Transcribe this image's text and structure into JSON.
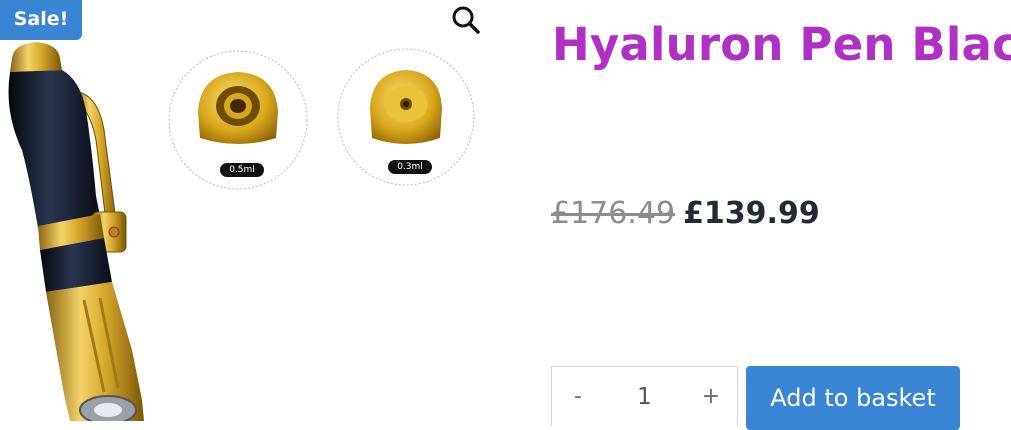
{
  "badge": {
    "sale": "Sale!"
  },
  "gallery": {
    "tip_large_label": "0.5ml",
    "tip_small_label": "0.3ml"
  },
  "product": {
    "title": "Hyaluron Pen Black",
    "old_price": "£176.49",
    "new_price": "£139.99"
  },
  "cart": {
    "minus": "-",
    "quantity": "1",
    "plus": "+",
    "add_label": "Add to basket"
  },
  "colors": {
    "accent": "#3a84d4",
    "title": "#b02fc4",
    "gold": "#d4a824",
    "pen_body": "#1b2033"
  },
  "icons": {
    "zoom": "magnifier-icon"
  }
}
